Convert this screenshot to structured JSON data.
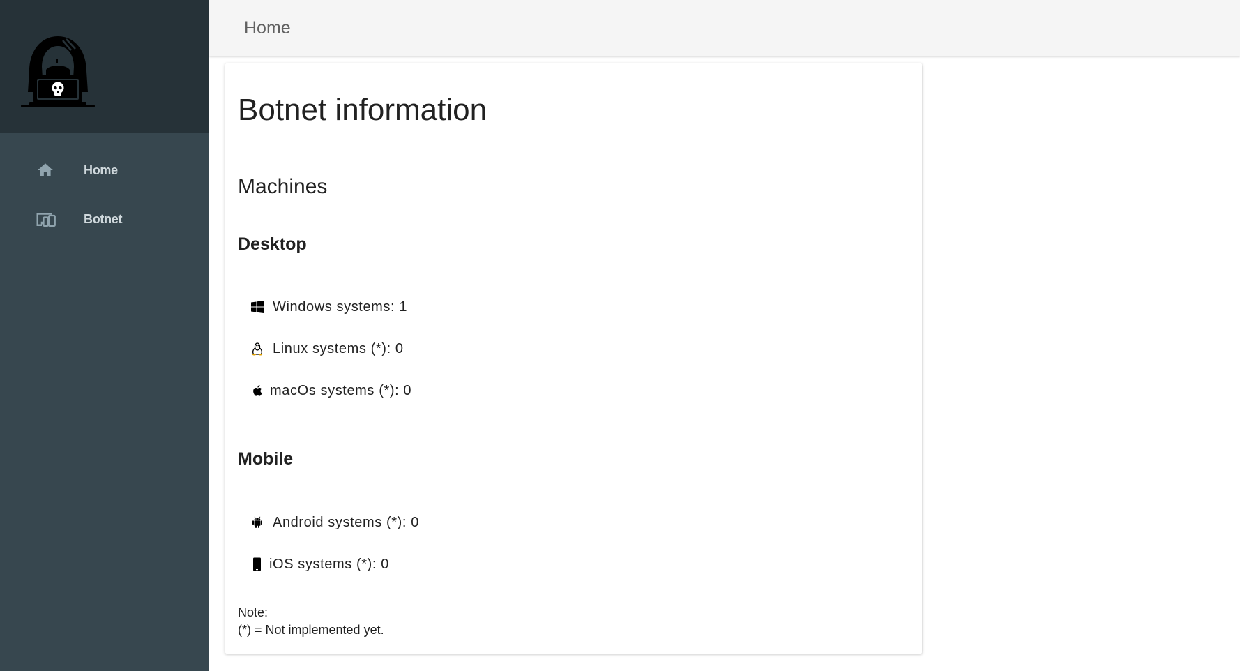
{
  "sidebar": {
    "logo_icon": "hacker-logo-icon",
    "items": [
      {
        "label": "Home",
        "icon": "home-icon"
      },
      {
        "label": "Botnet",
        "icon": "devices-icon"
      }
    ]
  },
  "topbar": {
    "title": "Home"
  },
  "main": {
    "title": "Botnet information",
    "section_title": "Machines",
    "desktop": {
      "title": "Desktop",
      "items": [
        {
          "icon": "windows-icon",
          "text": "Windows systems: 1"
        },
        {
          "icon": "linux-icon",
          "text": "Linux systems (*): 0"
        },
        {
          "icon": "apple-icon",
          "text": "macOs systems (*): 0"
        }
      ]
    },
    "mobile": {
      "title": "Mobile",
      "items": [
        {
          "icon": "android-icon",
          "text": "Android systems (*): 0"
        },
        {
          "icon": "phone-icon",
          "text": "iOS systems (*): 0"
        }
      ]
    },
    "note": {
      "label": "Note:",
      "text": "(*) = Not implemented yet."
    }
  },
  "colors": {
    "sidebar": "#37474f",
    "sidebar_header": "#263238",
    "topbar": "#f5f5f5",
    "nav_text": "#cfd8dc"
  }
}
